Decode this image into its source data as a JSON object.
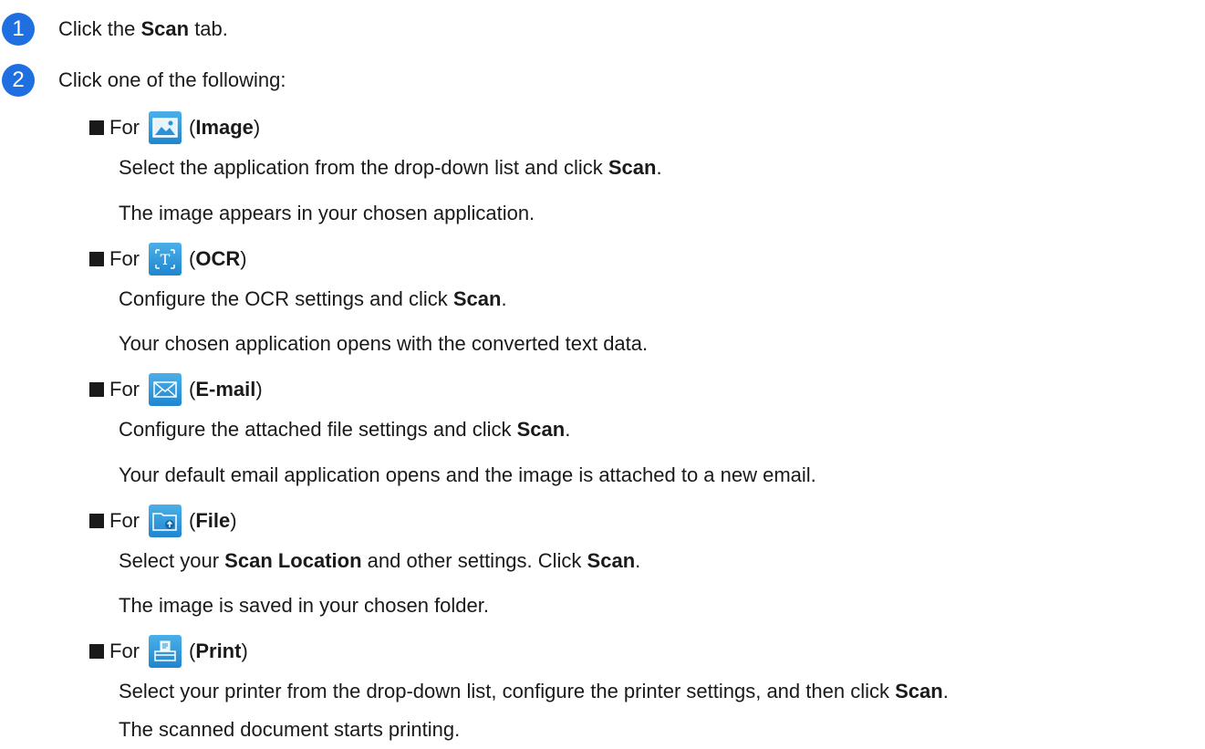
{
  "steps": [
    {
      "number": "1",
      "pre": "Click the ",
      "bold": "Scan",
      "post": " tab."
    },
    {
      "number": "2",
      "text": "Click one of the following:"
    }
  ],
  "options": [
    {
      "for": "For",
      "icon": "image-icon",
      "label": "Image",
      "lines": [
        {
          "pre": "Select the application from the drop-down list and click ",
          "bold": "Scan",
          "post": "."
        },
        {
          "pre": "The image appears in your chosen application.",
          "bold": "",
          "post": ""
        }
      ]
    },
    {
      "for": "For",
      "icon": "ocr-icon",
      "label": "OCR",
      "lines": [
        {
          "pre": "Configure the OCR settings and click ",
          "bold": "Scan",
          "post": "."
        },
        {
          "pre": "Your chosen application opens with the converted text data.",
          "bold": "",
          "post": ""
        }
      ]
    },
    {
      "for": "For",
      "icon": "email-icon",
      "label": "E-mail",
      "lines": [
        {
          "pre": "Configure the attached file settings and click ",
          "bold": "Scan",
          "post": "."
        },
        {
          "pre": "Your default email application opens and the image is attached to a new email.",
          "bold": "",
          "post": ""
        }
      ]
    },
    {
      "for": "For",
      "icon": "file-icon",
      "label": "File",
      "lines": [
        {
          "pre": "Select your ",
          "bold": "Scan Location",
          "post": " and other settings. Click ",
          "bold2": "Scan",
          "post2": "."
        },
        {
          "pre": "The image is saved in your chosen folder.",
          "bold": "",
          "post": ""
        }
      ]
    },
    {
      "for": "For",
      "icon": "print-icon",
      "label": "Print",
      "lines": [
        {
          "pre": "Select your printer from the drop-down list, configure the printer settings, and then click ",
          "bold": "Scan",
          "post": "."
        },
        {
          "pre": "The scanned document starts printing.",
          "bold": "",
          "post": ""
        }
      ]
    }
  ],
  "colors": {
    "badge": "#1f6fe0",
    "icon": "#2a93d8"
  }
}
